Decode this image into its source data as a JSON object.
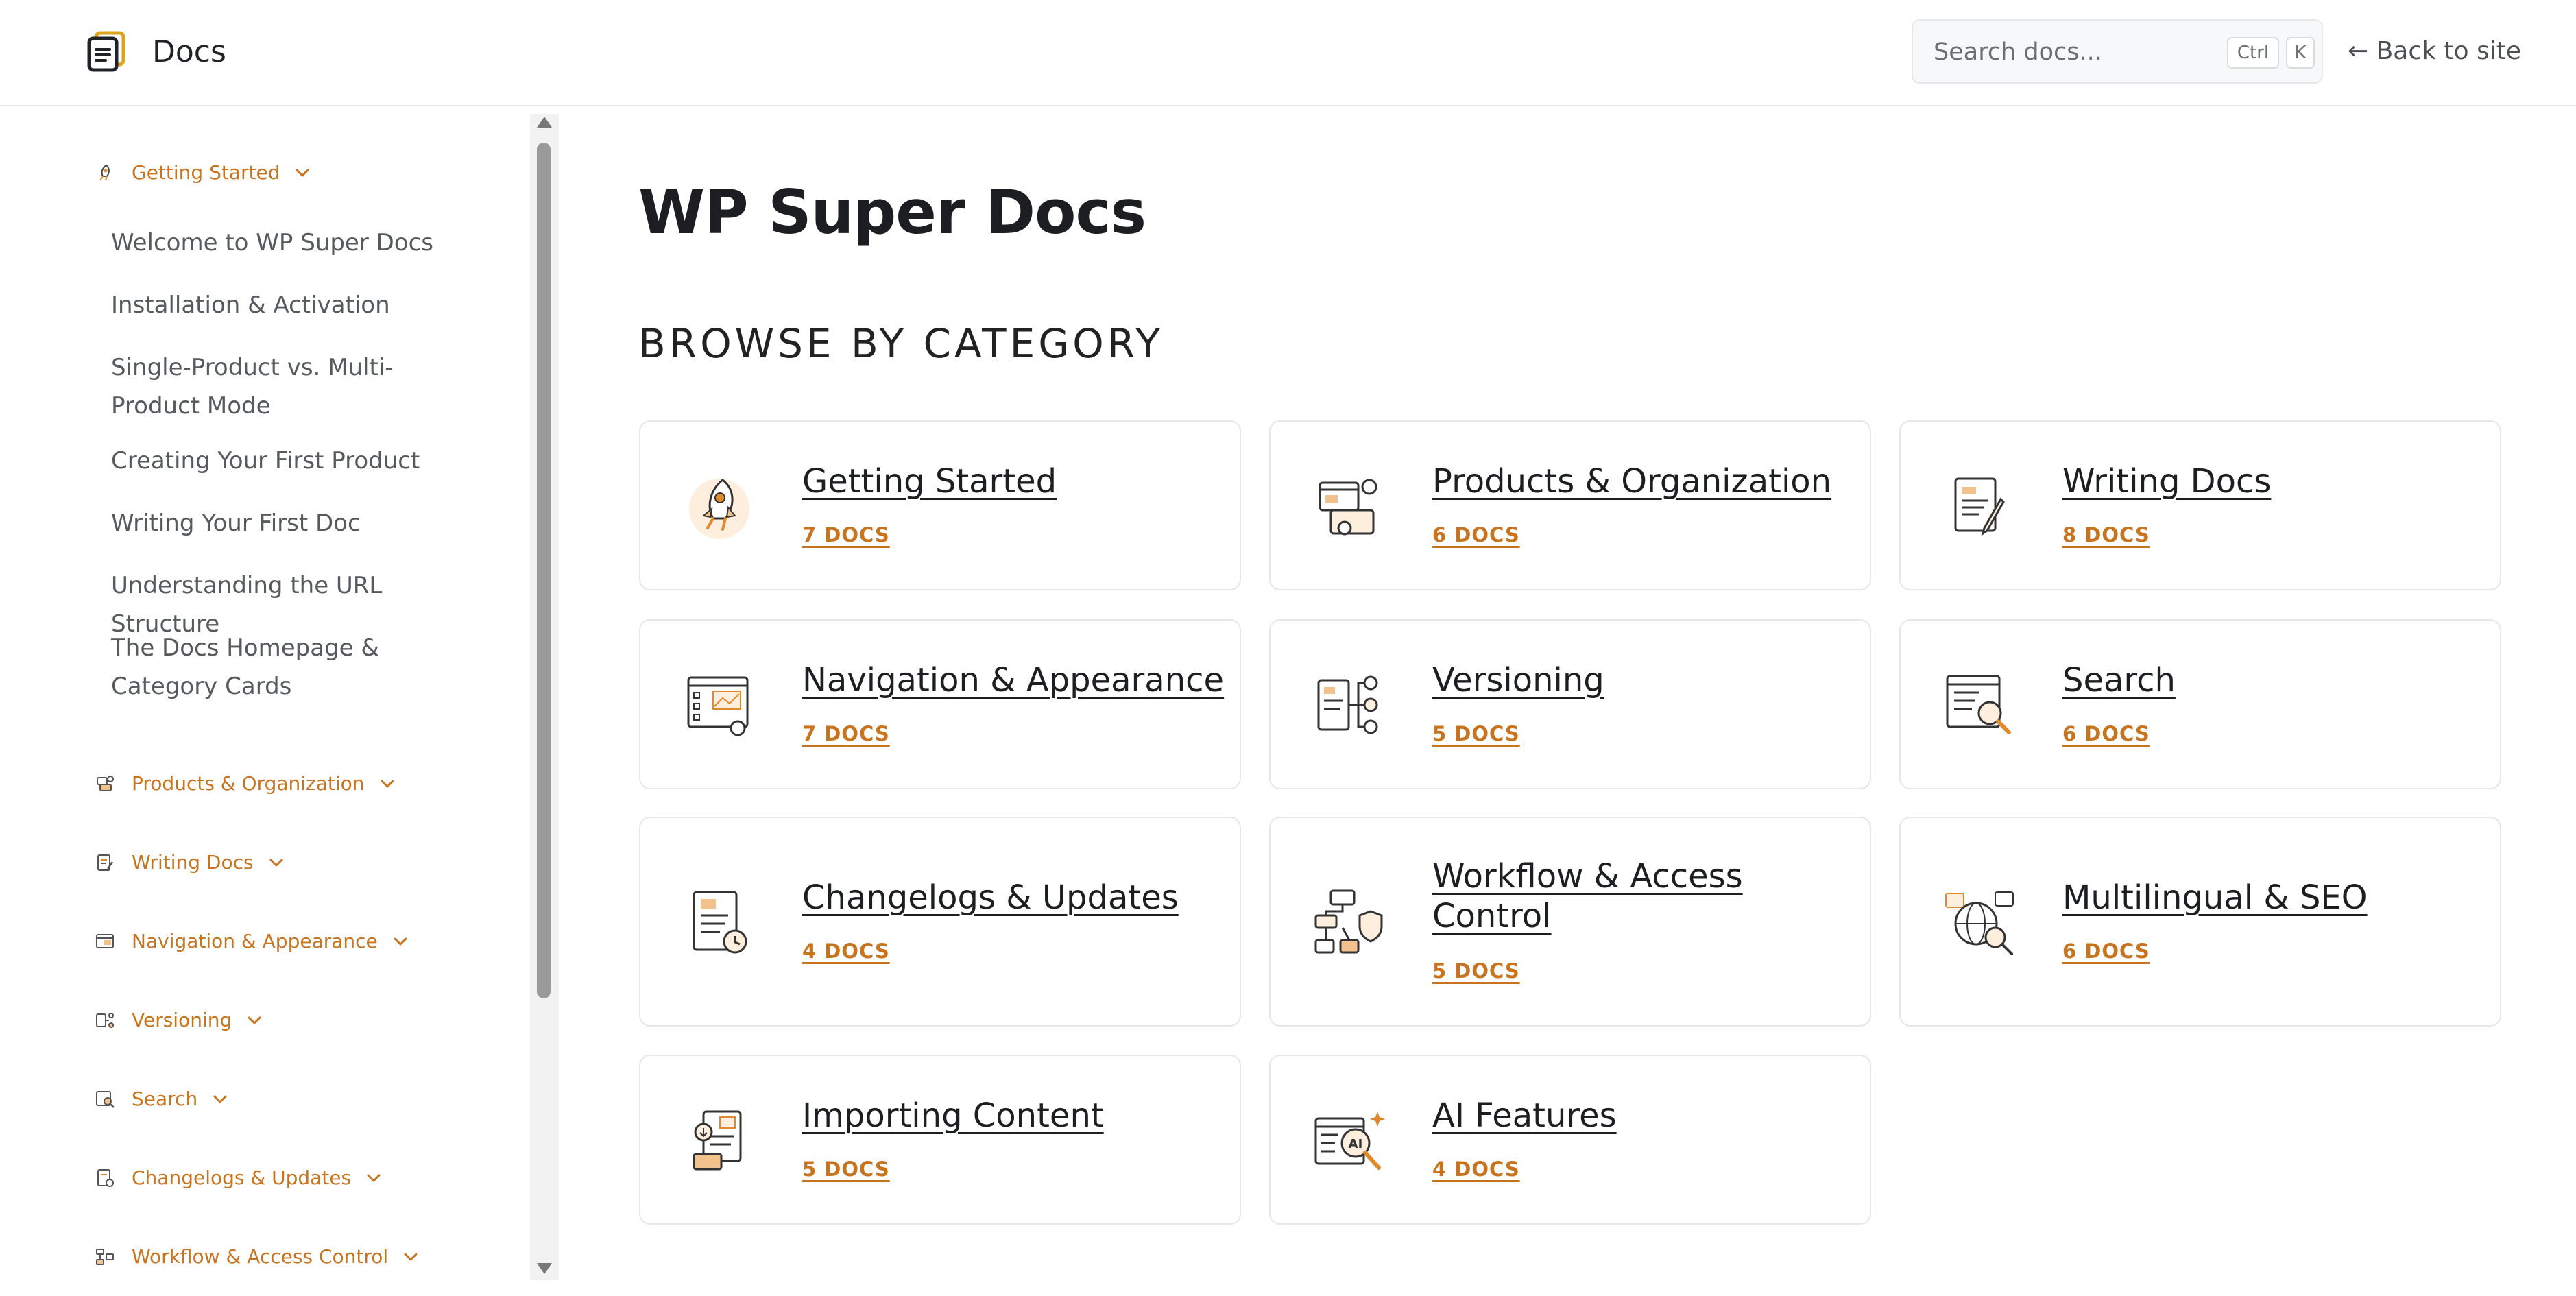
{
  "header": {
    "brand": "Docs",
    "search": {
      "placeholder": "Search docs...",
      "kbd_ctrl": "Ctrl",
      "kbd_k": "K"
    },
    "back_link": "← Back to site"
  },
  "sidebar": {
    "expanded_category": {
      "label": "Getting Started",
      "icon": "rocket-icon",
      "docs": [
        "Welcome to WP Super Docs",
        "Installation & Activation",
        "Single-Product vs. Multi-Product Mode",
        "Creating Your First Product",
        "Writing Your First Doc",
        "Understanding the URL Structure",
        "The Docs Homepage & Category Cards"
      ]
    },
    "categories": [
      {
        "label": "Products & Organization",
        "icon": "products-icon"
      },
      {
        "label": "Writing Docs",
        "icon": "writing-icon"
      },
      {
        "label": "Navigation & Appearance",
        "icon": "navigation-icon"
      },
      {
        "label": "Versioning",
        "icon": "versioning-icon"
      },
      {
        "label": "Search",
        "icon": "search-doc-icon"
      },
      {
        "label": "Changelogs & Updates",
        "icon": "changelog-icon"
      },
      {
        "label": "Workflow & Access Control",
        "icon": "workflow-icon"
      }
    ]
  },
  "main": {
    "title": "WP Super Docs",
    "section_title": "BROWSE BY CATEGORY",
    "cards": [
      {
        "title": "Getting Started",
        "count": "7 DOCS",
        "icon": "rocket-icon"
      },
      {
        "title": "Products & Organization",
        "count": "6 DOCS",
        "icon": "products-icon"
      },
      {
        "title": "Writing Docs",
        "count": "8 DOCS",
        "icon": "writing-icon"
      },
      {
        "title": "Navigation & Appearance",
        "count": "7 DOCS",
        "icon": "navigation-icon"
      },
      {
        "title": "Versioning",
        "count": "5 DOCS",
        "icon": "versioning-icon"
      },
      {
        "title": "Search",
        "count": "6 DOCS",
        "icon": "search-doc-icon"
      },
      {
        "title": "Changelogs & Updates",
        "count": "4 DOCS",
        "icon": "changelog-icon"
      },
      {
        "title": "Workflow & Access Control",
        "count": "5 DOCS",
        "icon": "workflow-icon"
      },
      {
        "title": "Multilingual & SEO",
        "count": "6 DOCS",
        "icon": "multilingual-icon"
      },
      {
        "title": "Importing Content",
        "count": "5 DOCS",
        "icon": "importing-icon"
      },
      {
        "title": "AI Features",
        "count": "4 DOCS",
        "icon": "ai-icon"
      }
    ]
  },
  "colors": {
    "accent": "#c8741f",
    "text": "#1f2328",
    "border": "#e5e7eb"
  }
}
